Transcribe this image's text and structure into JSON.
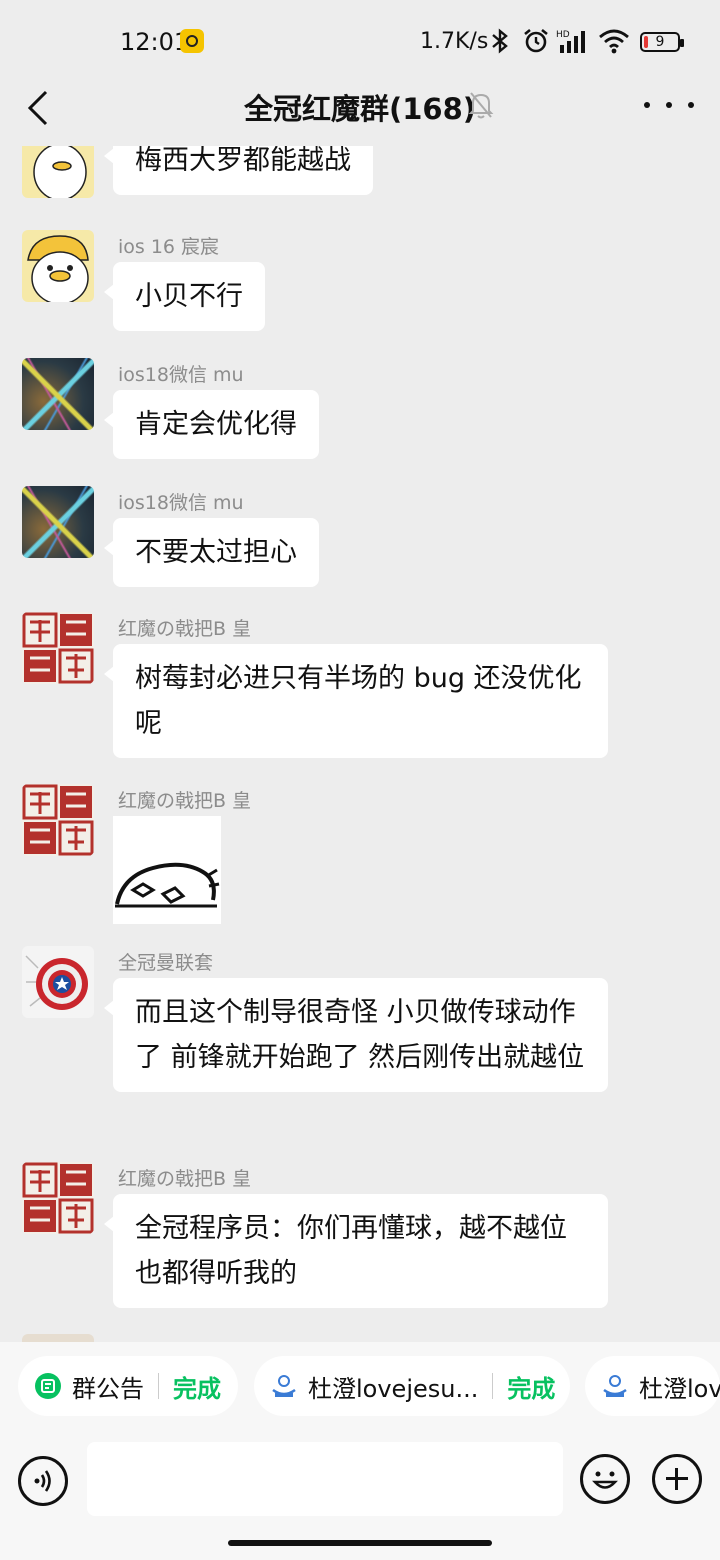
{
  "status_bar": {
    "time": "12:01",
    "speed": "1.7K/s",
    "battery": "9",
    "icons": [
      "notification-dot-icon",
      "bluetooth-icon",
      "alarm-icon",
      "hd-signal-icon",
      "wifi-icon",
      "battery-icon"
    ]
  },
  "header": {
    "title": "全冠红魔群(168)",
    "icons": [
      "back-icon",
      "mute-bell-icon",
      "more-icon"
    ]
  },
  "messages": [
    {
      "sender": "",
      "text": "梅西大罗都能越战",
      "avatar": "duck-avatar"
    },
    {
      "sender": "ios 16 宸宸",
      "text": "小贝不行",
      "avatar": "duck-avatar"
    },
    {
      "sender": "ios18微信  mu",
      "text": "肯定会优化得",
      "avatar": "network-avatar"
    },
    {
      "sender": "ios18微信  mu",
      "text": "不要太过担心",
      "avatar": "network-avatar"
    },
    {
      "sender": "红魔の戟把B 皇",
      "text": "树莓封必进只有半场的 bug 还没优化呢",
      "avatar": "seal-avatar"
    },
    {
      "sender": "红魔の戟把B 皇",
      "text": "",
      "sticker": "lying-cat-sticker",
      "avatar": "seal-avatar"
    },
    {
      "sender": "全冠曼联套",
      "text": "而且这个制导很奇怪  小贝做传球动作了  前锋就开始跑了 然后刚传出就越位",
      "avatar": "captain-shield-avatar"
    },
    {
      "sender": "红魔の戟把B 皇",
      "text": "全冠程序员：你们再懂球，越不越位也都得听我的",
      "avatar": "seal-avatar"
    }
  ],
  "bottom_bar": {
    "chips": [
      {
        "label": "群公告",
        "action": "完成",
        "icon": "announcement-icon"
      },
      {
        "label": "杜澄lovejesu...",
        "action": "完成",
        "icon": "app-icon"
      },
      {
        "label": "杜澄lov",
        "action": "",
        "icon": "app-icon"
      }
    ],
    "input_value": "",
    "icons": [
      "voice-icon",
      "emoji-icon",
      "plus-icon"
    ]
  }
}
